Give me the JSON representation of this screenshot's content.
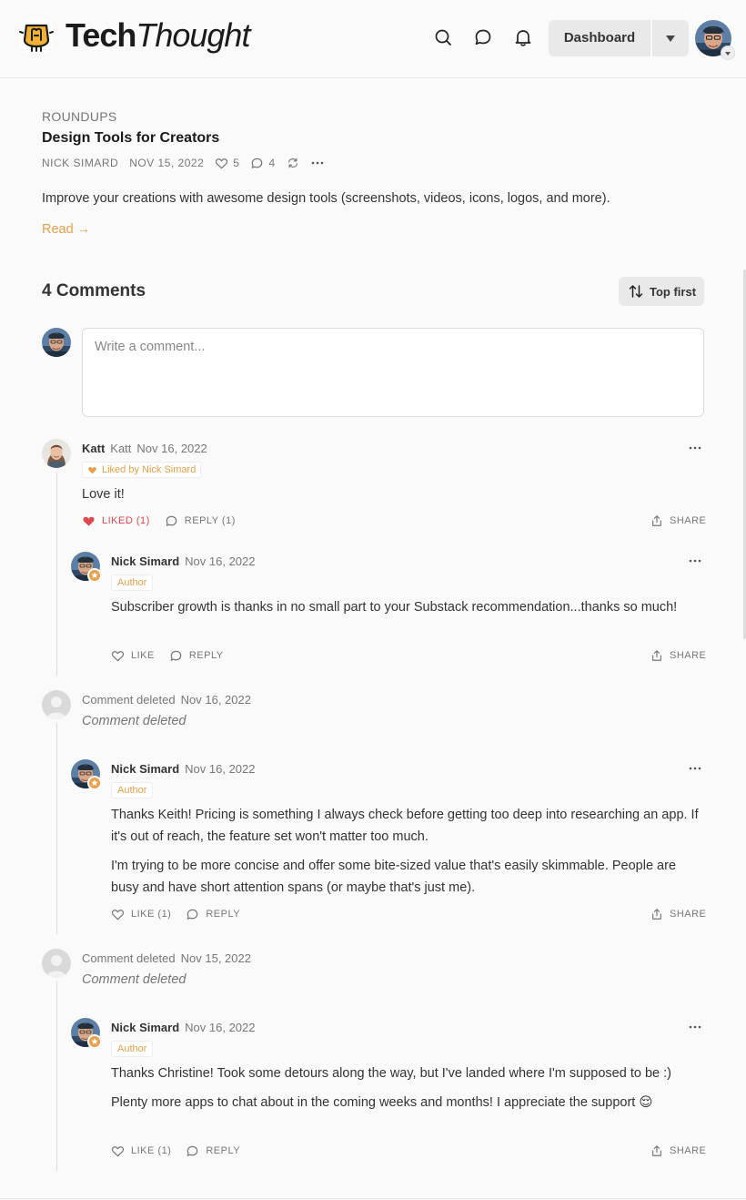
{
  "header": {
    "brand_bold": "Tech",
    "brand_italic": "Thought",
    "dashboard_label": "Dashboard"
  },
  "post": {
    "section": "ROUNDUPS",
    "title": "Design Tools for Creators",
    "author": "NICK SIMARD",
    "date": "NOV 15, 2022",
    "likes": "5",
    "comments": "4",
    "description": "Improve your creations with awesome design tools (screenshots, videos, icons, logos, and more).",
    "read_label": "Read →"
  },
  "comments_section": {
    "heading": "4 Comments",
    "sort_label": "Top first",
    "compose_placeholder": "Write a comment..."
  },
  "comments": [
    {
      "name": "Katt",
      "handle": "Katt",
      "date": "Nov 16, 2022",
      "liked_by": "Liked by Nick Simard",
      "body": "Love it!",
      "like_label": "LIKED (1)",
      "reply_label": "REPLY (1)",
      "share_label": "SHARE",
      "reply": {
        "name": "Nick Simard",
        "date": "Nov 16, 2022",
        "tag": "Author",
        "body": [
          "Subscriber growth is thanks in no small part to your Substack recommendation...thanks so much!"
        ],
        "like_label": "LIKE",
        "reply_label": "REPLY",
        "share_label": "SHARE"
      }
    },
    {
      "name": "Comment deleted",
      "date": "Nov 16, 2022",
      "body": "Comment deleted",
      "reply": {
        "name": "Nick Simard",
        "date": "Nov 16, 2022",
        "tag": "Author",
        "body": [
          "Thanks Keith! Pricing is something I always check before getting too deep into researching an app. If it's out of reach, the feature set won't matter too much.",
          "I'm trying to be more concise and offer some bite-sized value that's easily skimmable. People are busy and have short attention spans (or maybe that's just me)."
        ],
        "like_label": "LIKE (1)",
        "reply_label": "REPLY",
        "share_label": "SHARE"
      }
    },
    {
      "name": "Comment deleted",
      "date": "Nov 15, 2022",
      "body": "Comment deleted",
      "reply": {
        "name": "Nick Simard",
        "date": "Nov 16, 2022",
        "tag": "Author",
        "body": [
          "Thanks Christine! Took some detours along the way, but I've landed where I'm supposed to be :)",
          "Plenty more apps to chat about in the coming weeks and months! I appreciate the support 😌"
        ],
        "like_label": "LIKE (1)",
        "reply_label": "REPLY",
        "share_label": "SHARE"
      }
    }
  ],
  "colors": {
    "accent": "#e8a04a",
    "liked": "#e0474c",
    "muted": "#777777"
  },
  "icons": [
    "search-icon",
    "chat-icon",
    "bell-icon",
    "heart-icon",
    "comment-icon",
    "restack-icon",
    "more-icon",
    "sort-icon",
    "share-icon",
    "star-icon"
  ]
}
